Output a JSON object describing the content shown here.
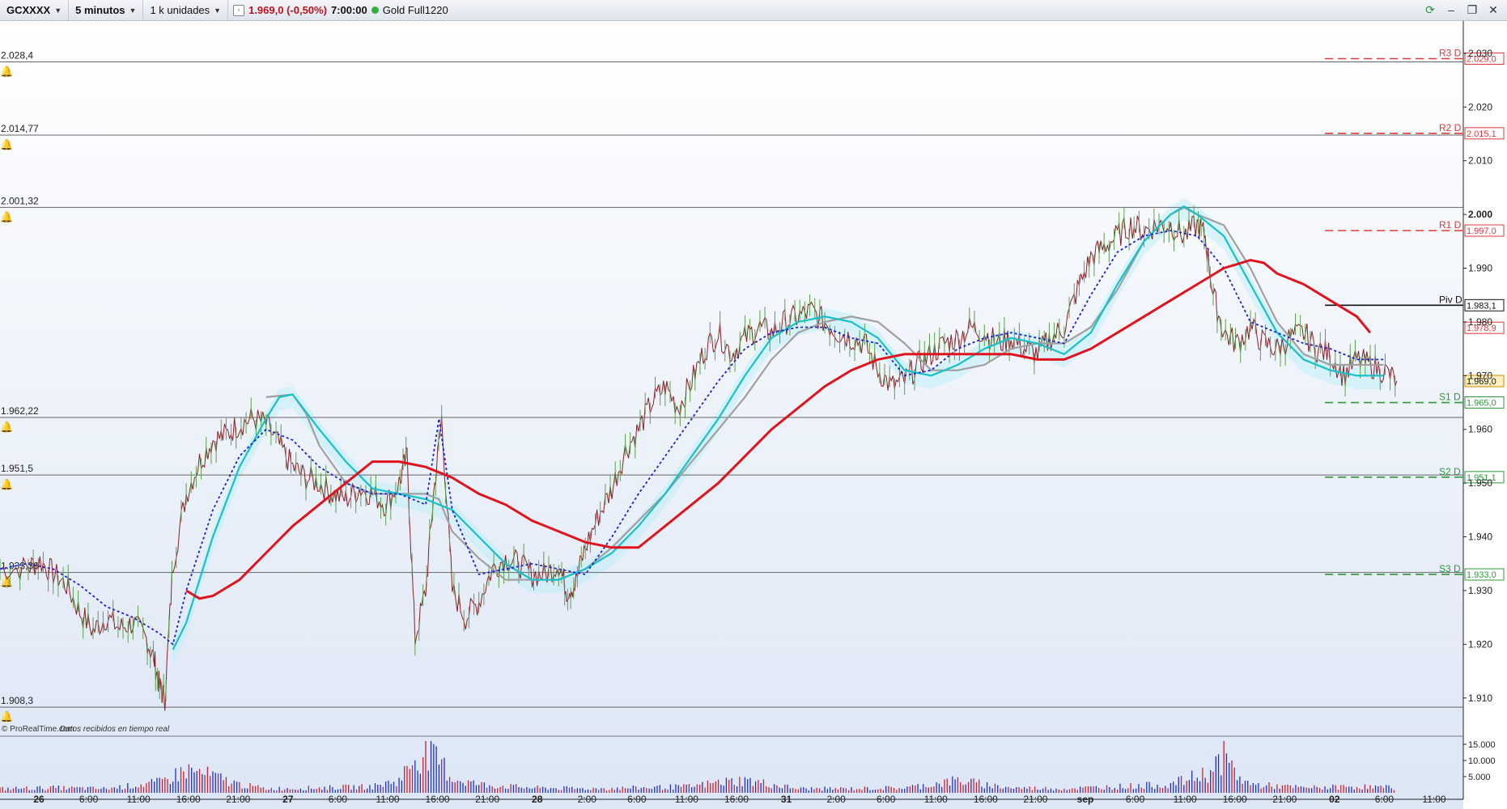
{
  "toolbar": {
    "instrument": "GCXXXX",
    "timeframe": "5 minutos",
    "units": "1 k unidades",
    "last_price": "1.969,0 (-0,50%)",
    "time": "7:00:00",
    "contract": "Gold Full1220"
  },
  "footer": {
    "source": "© ProRealTime.com",
    "realtime": "Datos recibidos en tiempo real"
  },
  "chart_data": {
    "type": "line",
    "x_labels": [
      "26",
      "6:00",
      "11:00",
      "16:00",
      "21:00",
      "27",
      "6:00",
      "11:00",
      "16:00",
      "21:00",
      "28",
      "2:00",
      "6:00",
      "11:00",
      "16:00",
      "31",
      "2:00",
      "6:00",
      "11:00",
      "16:00",
      "21:00",
      "sep",
      "6:00",
      "11:00",
      "16:00",
      "21:00",
      "02",
      "6:00",
      "11:00"
    ],
    "y_ticks": [
      "1.910",
      "1.920",
      "1.930",
      "1.940",
      "1.950",
      "1.960",
      "1.970",
      "1.980",
      "1.990",
      "2.000",
      "2.010",
      "2.020",
      "2.030"
    ],
    "ylim": [
      1905,
      2036
    ],
    "grid": false,
    "horizontal_levels": [
      {
        "label": "2.028,4",
        "value": 2028.4
      },
      {
        "label": "2.014,77",
        "value": 2014.77
      },
      {
        "label": "2.001,32",
        "value": 2001.32
      },
      {
        "label": "1.962,22",
        "value": 1962.22
      },
      {
        "label": "1.951,5",
        "value": 1951.5
      },
      {
        "label": "1.933,36",
        "value": 1933.36
      },
      {
        "label": "1.908,3",
        "value": 1908.3
      }
    ],
    "pivots": [
      {
        "name": "R3 D",
        "value": 2029.0,
        "tag": "2.029,0",
        "color": "#e0383a"
      },
      {
        "name": "R2 D",
        "value": 2015.1,
        "tag": "2.015,1",
        "color": "#e0383a"
      },
      {
        "name": "R1 D",
        "value": 1997.0,
        "tag": "1.997,0",
        "color": "#e0383a"
      },
      {
        "name": "Piv D",
        "value": 1983.1,
        "tag": "1.983,1",
        "color": "#111111"
      },
      {
        "name": "S1 D",
        "value": 1965.0,
        "tag": "1.965,0",
        "color": "#2c9a3a"
      },
      {
        "name": "S2 D",
        "value": 1951.1,
        "tag": "1.951,1",
        "color": "#2c9a3a"
      },
      {
        "name": "S3 D",
        "value": 1933.0,
        "tag": "1.933,0",
        "color": "#2c9a3a"
      }
    ],
    "axis_tags": [
      {
        "value": 1978.9,
        "tag": "1.978,9",
        "color": "#e0383a"
      },
      {
        "value": 1969.0,
        "tag": "1.969,0",
        "color": "#d08a00"
      }
    ],
    "price_series": [
      [
        0,
        1934
      ],
      [
        1,
        1934.2
      ],
      [
        1.5,
        1935.5
      ],
      [
        2,
        1933.2
      ],
      [
        2.5,
        1931
      ],
      [
        3,
        1926
      ],
      [
        3.5,
        1922.5
      ],
      [
        4,
        1925
      ],
      [
        4.5,
        1923
      ],
      [
        5,
        1924
      ],
      [
        5.5,
        1921
      ],
      [
        5.8,
        1917
      ],
      [
        6,
        1912
      ],
      [
        6.2,
        1910
      ],
      [
        6.5,
        1935
      ],
      [
        7,
        1948
      ],
      [
        7.5,
        1954
      ],
      [
        8,
        1958
      ],
      [
        8.5,
        1959
      ],
      [
        9,
        1961
      ],
      [
        9.5,
        1962
      ],
      [
        10,
        1961
      ],
      [
        10.5,
        1957
      ],
      [
        11,
        1953
      ],
      [
        11.5,
        1951
      ],
      [
        12,
        1950
      ],
      [
        12.5,
        1948
      ],
      [
        13,
        1947
      ],
      [
        13.5,
        1949
      ],
      [
        14,
        1948
      ],
      [
        14.5,
        1946
      ],
      [
        15,
        1950
      ],
      [
        15.3,
        1955
      ],
      [
        15.6,
        1921
      ],
      [
        16,
        1930
      ],
      [
        16.3,
        1948
      ],
      [
        16.6,
        1962
      ],
      [
        17,
        1930
      ],
      [
        17.5,
        1925
      ],
      [
        18,
        1928
      ],
      [
        18.5,
        1934
      ],
      [
        19,
        1936
      ],
      [
        19.5,
        1935
      ],
      [
        20,
        1933
      ],
      [
        20.5,
        1933
      ],
      [
        21,
        1935
      ],
      [
        21.3,
        1930
      ],
      [
        21.6,
        1931
      ],
      [
        22,
        1938
      ],
      [
        22.5,
        1944
      ],
      [
        23,
        1949
      ],
      [
        23.5,
        1956
      ],
      [
        24,
        1960
      ],
      [
        24.5,
        1965
      ],
      [
        25,
        1968
      ],
      [
        25.5,
        1964
      ],
      [
        26,
        1969
      ],
      [
        26.5,
        1975
      ],
      [
        27,
        1978
      ],
      [
        27.5,
        1974
      ],
      [
        28,
        1977
      ],
      [
        28.5,
        1979
      ],
      [
        29,
        1978
      ],
      [
        29.5,
        1980
      ],
      [
        30,
        1981
      ],
      [
        30.5,
        1982
      ],
      [
        31,
        1980
      ],
      [
        31.5,
        1978
      ],
      [
        32,
        1977
      ],
      [
        32.5,
        1976
      ],
      [
        33,
        1971
      ],
      [
        33.5,
        1968
      ],
      [
        34,
        1969
      ],
      [
        34.5,
        1972
      ],
      [
        35,
        1974
      ],
      [
        35.5,
        1976
      ],
      [
        36,
        1977
      ],
      [
        36.5,
        1979
      ],
      [
        37,
        1978
      ],
      [
        37.5,
        1976
      ],
      [
        38,
        1977
      ],
      [
        38.5,
        1975
      ],
      [
        39,
        1974
      ],
      [
        39.5,
        1977
      ],
      [
        40,
        1979
      ],
      [
        40.5,
        1986
      ],
      [
        41,
        1992
      ],
      [
        41.5,
        1994
      ],
      [
        42,
        1996
      ],
      [
        42.5,
        1998
      ],
      [
        43,
        1997
      ],
      [
        43.5,
        1998
      ],
      [
        44,
        1998
      ],
      [
        44.5,
        1996
      ],
      [
        45,
        1998
      ],
      [
        45.3,
        1996
      ],
      [
        45.6,
        1985
      ],
      [
        46,
        1978
      ],
      [
        46.5,
        1976
      ],
      [
        47,
        1979
      ],
      [
        47.5,
        1976
      ],
      [
        48,
        1975
      ],
      [
        48.5,
        1977
      ],
      [
        49,
        1978
      ],
      [
        49.5,
        1975
      ],
      [
        50,
        1974
      ],
      [
        50.5,
        1970
      ],
      [
        51,
        1973
      ],
      [
        51.5,
        1972
      ],
      [
        52,
        1971
      ],
      [
        52.5,
        1969
      ]
    ],
    "ma_red": [
      [
        7,
        1930
      ],
      [
        7.5,
        1928.5
      ],
      [
        8,
        1929
      ],
      [
        9,
        1932
      ],
      [
        10,
        1937
      ],
      [
        11,
        1942
      ],
      [
        12,
        1946
      ],
      [
        13,
        1950
      ],
      [
        14,
        1954
      ],
      [
        14.5,
        1954
      ],
      [
        15,
        1954
      ],
      [
        16,
        1953
      ],
      [
        17,
        1951
      ],
      [
        18,
        1948
      ],
      [
        19,
        1946
      ],
      [
        20,
        1943
      ],
      [
        21,
        1941
      ],
      [
        22,
        1939
      ],
      [
        23,
        1938
      ],
      [
        24,
        1938
      ],
      [
        25,
        1942
      ],
      [
        26,
        1946
      ],
      [
        27,
        1950
      ],
      [
        28,
        1955
      ],
      [
        29,
        1960
      ],
      [
        30,
        1964
      ],
      [
        31,
        1968
      ],
      [
        32,
        1971
      ],
      [
        33,
        1973
      ],
      [
        34,
        1974
      ],
      [
        35,
        1974
      ],
      [
        36,
        1974
      ],
      [
        37,
        1974
      ],
      [
        38,
        1974
      ],
      [
        39,
        1973
      ],
      [
        40,
        1973
      ],
      [
        41,
        1975
      ],
      [
        42,
        1978
      ],
      [
        43,
        1981
      ],
      [
        44,
        1984
      ],
      [
        45,
        1987
      ],
      [
        46,
        1990
      ],
      [
        47,
        1991.5
      ],
      [
        47.5,
        1991
      ],
      [
        48,
        1989
      ],
      [
        49,
        1987
      ],
      [
        50,
        1984
      ],
      [
        51,
        1981
      ],
      [
        51.5,
        1978
      ]
    ],
    "ma_blue_dotted": [
      [
        0,
        1934
      ],
      [
        1,
        1935
      ],
      [
        2,
        1934
      ],
      [
        3,
        1931
      ],
      [
        4,
        1927
      ],
      [
        5,
        1925
      ],
      [
        6,
        1922
      ],
      [
        6.5,
        1920
      ],
      [
        7,
        1930
      ],
      [
        8,
        1945
      ],
      [
        9,
        1955
      ],
      [
        10,
        1960
      ],
      [
        11,
        1958
      ],
      [
        12,
        1953
      ],
      [
        13,
        1950
      ],
      [
        14,
        1948
      ],
      [
        15,
        1948
      ],
      [
        16,
        1946
      ],
      [
        16.5,
        1962
      ],
      [
        17,
        1945
      ],
      [
        18,
        1933
      ],
      [
        19,
        1934
      ],
      [
        20,
        1935
      ],
      [
        21,
        1934
      ],
      [
        22,
        1933
      ],
      [
        23,
        1940
      ],
      [
        24,
        1948
      ],
      [
        25,
        1955
      ],
      [
        26,
        1962
      ],
      [
        27,
        1969
      ],
      [
        28,
        1975
      ],
      [
        29,
        1978
      ],
      [
        30,
        1979
      ],
      [
        31,
        1979
      ],
      [
        32,
        1977
      ],
      [
        33,
        1976
      ],
      [
        34,
        1970
      ],
      [
        35,
        1971
      ],
      [
        36,
        1975
      ],
      [
        37,
        1977
      ],
      [
        38,
        1978
      ],
      [
        39,
        1977
      ],
      [
        40,
        1976
      ],
      [
        41,
        1985
      ],
      [
        42,
        1993
      ],
      [
        43,
        1996
      ],
      [
        44,
        1997
      ],
      [
        45,
        1996
      ],
      [
        46,
        1990
      ],
      [
        47,
        1980
      ],
      [
        48,
        1978
      ],
      [
        49,
        1976
      ],
      [
        50,
        1975
      ],
      [
        51,
        1973
      ],
      [
        52,
        1973
      ]
    ],
    "ma_cyan": [
      [
        6.5,
        1919
      ],
      [
        7,
        1924
      ],
      [
        8,
        1940
      ],
      [
        9,
        1953
      ],
      [
        10,
        1962
      ],
      [
        10.5,
        1966
      ],
      [
        11,
        1966.5
      ],
      [
        12,
        1960
      ],
      [
        13,
        1954
      ],
      [
        14,
        1949
      ],
      [
        15,
        1948
      ],
      [
        16,
        1947
      ],
      [
        17,
        1945
      ],
      [
        18,
        1940
      ],
      [
        19,
        1935
      ],
      [
        20,
        1932
      ],
      [
        21,
        1932
      ],
      [
        22,
        1934
      ],
      [
        23,
        1937
      ],
      [
        24,
        1942
      ],
      [
        25,
        1948
      ],
      [
        26,
        1955
      ],
      [
        27,
        1962
      ],
      [
        28,
        1970
      ],
      [
        29,
        1977
      ],
      [
        30,
        1980
      ],
      [
        31,
        1981
      ],
      [
        32,
        1980
      ],
      [
        33,
        1977
      ],
      [
        34,
        1971
      ],
      [
        35,
        1970
      ],
      [
        36,
        1972
      ],
      [
        37,
        1975
      ],
      [
        38,
        1977
      ],
      [
        39,
        1976
      ],
      [
        40,
        1974
      ],
      [
        41,
        1978
      ],
      [
        42,
        1987
      ],
      [
        43,
        1995
      ],
      [
        44,
        2000
      ],
      [
        44.5,
        2001.5
      ],
      [
        45,
        2000
      ],
      [
        46,
        1996
      ],
      [
        47,
        1987
      ],
      [
        48,
        1978
      ],
      [
        49,
        1973
      ],
      [
        50,
        1971
      ],
      [
        51,
        1970
      ],
      [
        52,
        1970
      ]
    ],
    "ma_gray": [
      [
        10,
        1966
      ],
      [
        11,
        1966.5
      ],
      [
        11.5,
        1963
      ],
      [
        12,
        1957
      ],
      [
        13,
        1950
      ],
      [
        14,
        1948
      ],
      [
        15,
        1948
      ],
      [
        16,
        1948
      ],
      [
        16.5,
        1947
      ],
      [
        17,
        1941
      ],
      [
        18,
        1936
      ],
      [
        19,
        1932
      ],
      [
        20,
        1932
      ],
      [
        21,
        1932
      ],
      [
        22,
        1934
      ],
      [
        23,
        1938
      ],
      [
        24,
        1943
      ],
      [
        25,
        1948
      ],
      [
        26,
        1954
      ],
      [
        27,
        1960
      ],
      [
        28,
        1966
      ],
      [
        29,
        1973
      ],
      [
        30,
        1978
      ],
      [
        31,
        1980
      ],
      [
        32,
        1981
      ],
      [
        33,
        1980
      ],
      [
        34,
        1976
      ],
      [
        35,
        1971
      ],
      [
        36,
        1971
      ],
      [
        37,
        1972
      ],
      [
        38,
        1975
      ],
      [
        39,
        1976
      ],
      [
        40,
        1976
      ],
      [
        41,
        1979
      ],
      [
        42,
        1986
      ],
      [
        43,
        1995
      ],
      [
        44,
        2000
      ],
      [
        44.5,
        2001.3
      ],
      [
        45,
        2000
      ],
      [
        46,
        1998
      ],
      [
        47,
        1990
      ],
      [
        48,
        1980
      ],
      [
        49,
        1974
      ],
      [
        50,
        1972
      ],
      [
        51,
        1972
      ],
      [
        52,
        1972
      ]
    ],
    "volume": [
      [
        0,
        0.1
      ],
      [
        2,
        0.12
      ],
      [
        4,
        0.1
      ],
      [
        6,
        0.25
      ],
      [
        7,
        0.55
      ],
      [
        8,
        0.4
      ],
      [
        9,
        0.2
      ],
      [
        10,
        0.1
      ],
      [
        12,
        0.12
      ],
      [
        14,
        0.15
      ],
      [
        15,
        0.3
      ],
      [
        15.6,
        0.85
      ],
      [
        16,
        0.95
      ],
      [
        16.6,
        0.7
      ],
      [
        17,
        0.35
      ],
      [
        18,
        0.2
      ],
      [
        20,
        0.12
      ],
      [
        22,
        0.1
      ],
      [
        24,
        0.12
      ],
      [
        26,
        0.15
      ],
      [
        27,
        0.25
      ],
      [
        28,
        0.3
      ],
      [
        29,
        0.2
      ],
      [
        30,
        0.1
      ],
      [
        32,
        0.1
      ],
      [
        34,
        0.12
      ],
      [
        35,
        0.2
      ],
      [
        36,
        0.3
      ],
      [
        37,
        0.2
      ],
      [
        38,
        0.12
      ],
      [
        40,
        0.1
      ],
      [
        42,
        0.15
      ],
      [
        44,
        0.2
      ],
      [
        45.5,
        0.5
      ],
      [
        46,
        0.9
      ],
      [
        46.5,
        0.4
      ],
      [
        47,
        0.2
      ],
      [
        49,
        0.12
      ],
      [
        51,
        0.15
      ],
      [
        52.5,
        0.12
      ]
    ],
    "volume_ticks": [
      "15.000",
      "10.000",
      "5.000"
    ]
  },
  "colors": {
    "ma_red": "#e0141e",
    "ma_cyan": "#19c0c8",
    "ma_gray": "#a0a0a0",
    "ma_blue_dotted": "#1a22d8",
    "price": "#8c1e28",
    "price_up": "#5da04a",
    "cloud": "#bfeef8",
    "bg_top": "#ffffff",
    "bg_bottom": "#dce6f5"
  },
  "icons": [
    "dropdown-caret-icon",
    "quote-square-icon",
    "connection-dot-icon",
    "refresh-icon",
    "minimize-icon",
    "restore-icon",
    "close-icon",
    "alarm-bell-icon"
  ]
}
